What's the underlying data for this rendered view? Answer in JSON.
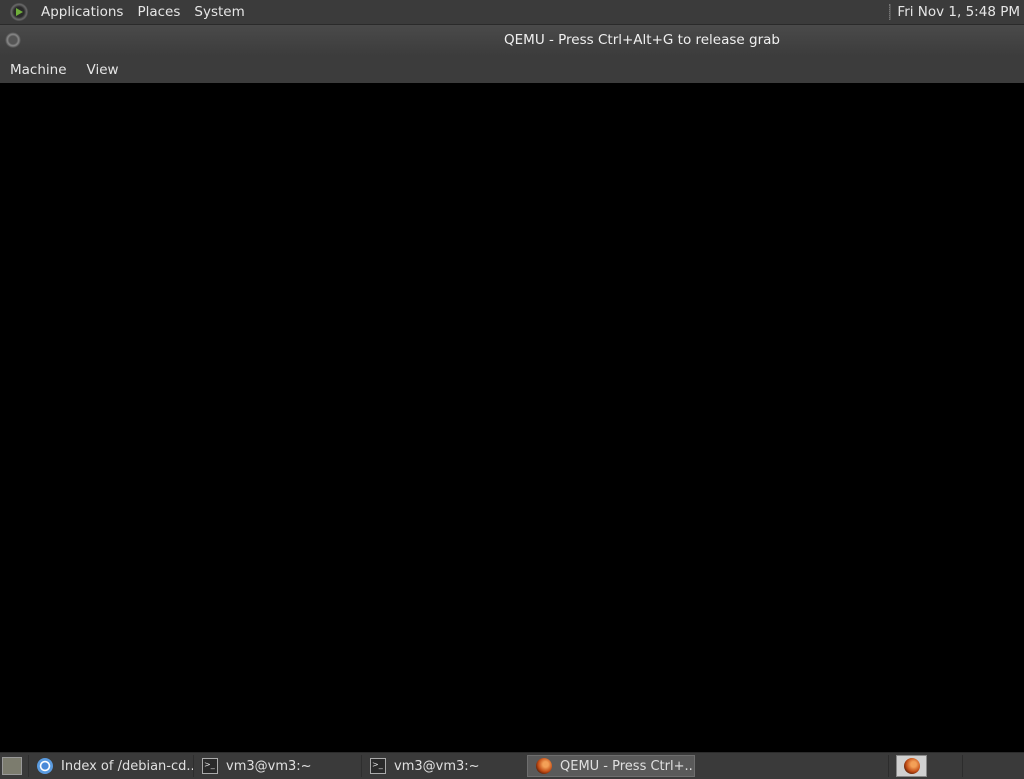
{
  "top_panel": {
    "menu_items": [
      "Applications",
      "Places",
      "System"
    ],
    "clock": "Fri Nov  1,  5:48 PM"
  },
  "window": {
    "title": "QEMU - Press Ctrl+Alt+G to release grab",
    "menu_items": [
      "Machine",
      "View"
    ]
  },
  "taskbar": {
    "tasks": [
      {
        "label": "Index of /debian-cd...",
        "icon": "chrome-icon",
        "active": false
      },
      {
        "label": "vm3@vm3:~",
        "icon": "terminal-icon",
        "active": false
      },
      {
        "label": "vm3@vm3:~",
        "icon": "terminal-icon",
        "active": false
      },
      {
        "label": "QEMU - Press Ctrl+...",
        "icon": "qemu-icon",
        "active": true
      }
    ]
  }
}
